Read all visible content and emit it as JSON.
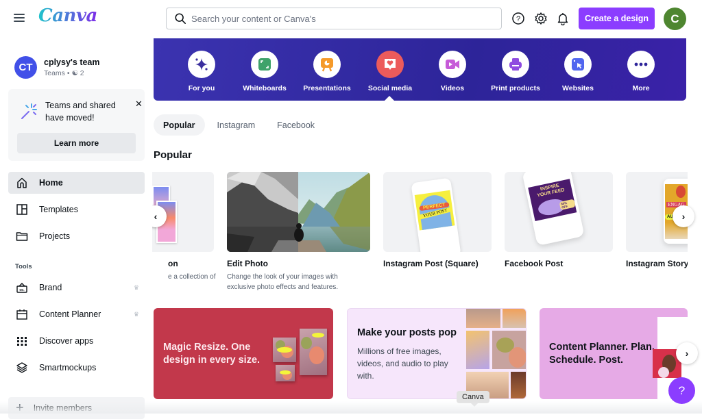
{
  "header": {
    "logo": "Canva",
    "search_placeholder": "Search your content or Canva's",
    "search_value": "",
    "create_button": "Create a design",
    "user_initial": "C",
    "icons": [
      "help-icon",
      "settings-icon",
      "notifications-icon"
    ]
  },
  "sidebar": {
    "team": {
      "initials": "CT",
      "name": "cplysy's team",
      "subtitle": "Teams • ",
      "member_count": "2"
    },
    "notice": {
      "message": "Teams and shared have moved!",
      "button": "Learn more"
    },
    "nav": [
      {
        "label": "Home",
        "icon": "home-icon",
        "active": true
      },
      {
        "label": "Templates",
        "icon": "templates-icon"
      },
      {
        "label": "Projects",
        "icon": "folder-icon"
      }
    ],
    "tools_heading": "Tools",
    "tools": [
      {
        "label": "Brand",
        "icon": "brand-icon",
        "premium": true
      },
      {
        "label": "Content Planner",
        "icon": "calendar-icon",
        "premium": true
      },
      {
        "label": "Discover apps",
        "icon": "apps-grid-icon"
      },
      {
        "label": "Smartmockups",
        "icon": "layers-icon"
      }
    ],
    "invite": "Invite members"
  },
  "categories": {
    "items": [
      {
        "label": "For you",
        "icon": "sparkle-icon",
        "color": "#3b2f9e"
      },
      {
        "label": "Whiteboards",
        "icon": "whiteboard-icon",
        "color": "#3fa26a"
      },
      {
        "label": "Presentations",
        "icon": "presentation-icon",
        "color": "#f59a2a"
      },
      {
        "label": "Social media",
        "icon": "heart-message-icon",
        "color": "#ec5b5b",
        "active": true
      },
      {
        "label": "Videos",
        "icon": "video-camera-icon",
        "color": "#c65bd8"
      },
      {
        "label": "Print products",
        "icon": "printer-icon",
        "color": "#8e4be0"
      },
      {
        "label": "Websites",
        "icon": "website-cursor-icon",
        "color": "#5166ef"
      },
      {
        "label": "More",
        "icon": "more-dots-icon",
        "color": "#2d2499"
      }
    ]
  },
  "tabs": [
    {
      "label": "Popular",
      "active": true
    },
    {
      "label": "Instagram"
    },
    {
      "label": "Facebook"
    }
  ],
  "section_title": "Popular",
  "cards": [
    {
      "title": "on",
      "desc": "e a collection of"
    },
    {
      "title": "Edit Photo",
      "desc": "Change the look of your images with exclusive photo effects and features."
    },
    {
      "title": "Instagram Post (Square)",
      "desc": "",
      "art_text": [
        "PERFECT",
        "YOUR POST"
      ]
    },
    {
      "title": "Facebook Post",
      "desc": "",
      "art_text": [
        "INSPIRE",
        "YOUR FEED",
        "60% OFF"
      ]
    },
    {
      "title": "Instagram Story",
      "desc": "",
      "art_text": [
        "ENGAG",
        "AU"
      ]
    }
  ],
  "banners": [
    {
      "text": "Magic Resize. One design in every size.",
      "bg": "#c2384b"
    },
    {
      "title": "Make your posts pop",
      "text": "Millions of free images, videos, and audio to play with.",
      "bg": "#f6e6fb"
    },
    {
      "text": "Content Planner. Plan. Schedule. Post.",
      "bg": "#e6aae6"
    }
  ],
  "tooltip": "Canva",
  "help_fab": "?"
}
